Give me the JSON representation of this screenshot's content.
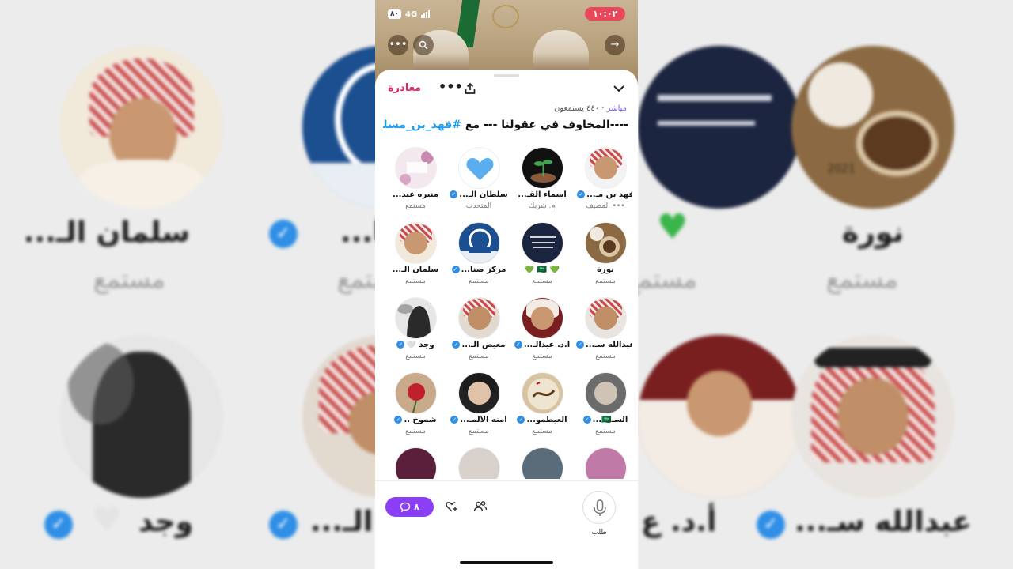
{
  "status_bar": {
    "time": "١٠:٠٢",
    "network": "4G",
    "battery": "٨٠"
  },
  "space": {
    "leave_label": "مغادرة",
    "live_label": "مباشر",
    "listeners": "٤٤٠ يستمعون",
    "title_prefix": "----المخاوف في عقولنا --- مع ",
    "title_tag": "#فهد_بن_مسلم"
  },
  "participants": [
    {
      "name": "فهد بن مـ...",
      "role": "••• المضيف",
      "verified": true
    },
    {
      "name": "أسماء القـ...",
      "role": "م. شريك",
      "verified": false
    },
    {
      "name": "سلطان الـ...",
      "role": "المتحدث",
      "verified": true
    },
    {
      "name": "منيره عبد...",
      "role": "مستمع",
      "verified": false
    },
    {
      "name": "نورة",
      "role": "مستمع",
      "verified": false
    },
    {
      "name": "💚 🇸🇦 💚",
      "role": "مستمع",
      "verified": false
    },
    {
      "name": "مركز صنا...",
      "role": "مستمع",
      "verified": true
    },
    {
      "name": "سلمان الـ...",
      "role": "مستمع",
      "verified": false
    },
    {
      "name": "عبدالله سـ...",
      "role": "مستمع",
      "verified": true
    },
    {
      "name": "أ.د. عبدالـ...",
      "role": "مستمع",
      "verified": true
    },
    {
      "name": "معيض الـ...",
      "role": "مستمع",
      "verified": true
    },
    {
      "name": "وجد 🤍",
      "role": "مستمع",
      "verified": true
    },
    {
      "name": "السـ🇸🇦...",
      "role": "مستمع",
      "verified": true
    },
    {
      "name": "العيطمو...",
      "role": "مستمع",
      "verified": true
    },
    {
      "name": "أمنه الألمـ...",
      "role": "مستمع",
      "verified": true
    },
    {
      "name": "شموخ ..",
      "role": "مستمع",
      "verified": true
    },
    {
      "name": "",
      "role": "",
      "verified": false
    },
    {
      "name": "",
      "role": "",
      "verified": false
    },
    {
      "name": "",
      "role": "",
      "verified": false
    },
    {
      "name": "",
      "role": "",
      "verified": false
    }
  ],
  "bottom": {
    "reply_count": "٨",
    "request_label": "طلب"
  },
  "background": {
    "name_1": "سلمان الـ...",
    "name_2": "صنا...",
    "name_3": "نورة",
    "name_4": "وجد",
    "name_5": "ن الـ...",
    "name_6": "أ.د. ع",
    "name_7": "عبدالله سـ...",
    "role": "مستمع",
    "seal_year": "2021"
  },
  "colors": {
    "accent": "#7856ff",
    "leave": "#e0245e",
    "link": "#1d9bf0",
    "reply": "#8a3ef5",
    "verified": "#2f8fe6"
  }
}
